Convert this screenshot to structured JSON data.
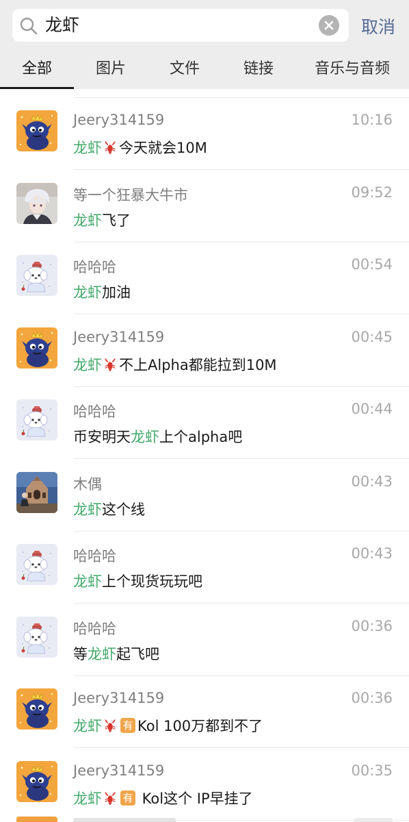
{
  "search": {
    "query": "龙虾",
    "cancel_label": "取消"
  },
  "tabs": [
    {
      "label": "全部",
      "active": true
    },
    {
      "label": "图片",
      "active": false
    },
    {
      "label": "文件",
      "active": false
    },
    {
      "label": "链接",
      "active": false
    },
    {
      "label": "音乐与音频",
      "active": false
    }
  ],
  "colors": {
    "highlight": "#42a96a",
    "cancel": "#576b95",
    "badge": "#f0a54b"
  },
  "results": [
    {
      "name": "Jeery314159",
      "time": "10:16",
      "avatar": "dragon-avatar",
      "message": [
        {
          "t": "龙虾",
          "hl": true
        },
        {
          "icon": "lobster"
        },
        {
          "t": "今天就会10M"
        }
      ]
    },
    {
      "name": "等一个狂暴大牛市",
      "time": "09:52",
      "avatar": "anime-boy-avatar",
      "message": [
        {
          "t": "龙虾",
          "hl": true
        },
        {
          "t": "飞了"
        }
      ]
    },
    {
      "name": "哈哈哈",
      "time": "00:54",
      "avatar": "dog-avatar",
      "message": [
        {
          "t": "龙虾",
          "hl": true
        },
        {
          "t": "加油"
        }
      ]
    },
    {
      "name": "Jeery314159",
      "time": "00:45",
      "avatar": "dragon-avatar",
      "message": [
        {
          "t": "龙虾",
          "hl": true
        },
        {
          "icon": "lobster"
        },
        {
          "t": "不上Alpha都能拉到10M"
        }
      ]
    },
    {
      "name": "哈哈哈",
      "time": "00:44",
      "avatar": "dog-avatar",
      "message": [
        {
          "t": "币安明天"
        },
        {
          "t": "龙虾",
          "hl": true
        },
        {
          "t": "上个alpha吧"
        }
      ]
    },
    {
      "name": "木偶",
      "time": "00:43",
      "avatar": "church-avatar",
      "message": [
        {
          "t": "龙虾",
          "hl": true
        },
        {
          "t": "这个线"
        }
      ]
    },
    {
      "name": "哈哈哈",
      "time": "00:43",
      "avatar": "dog-avatar",
      "message": [
        {
          "t": "龙虾",
          "hl": true
        },
        {
          "t": "上个现货玩玩吧"
        }
      ]
    },
    {
      "name": "哈哈哈",
      "time": "00:36",
      "avatar": "dog-avatar",
      "message": [
        {
          "t": "等"
        },
        {
          "t": "龙虾",
          "hl": true
        },
        {
          "t": "起飞吧"
        }
      ]
    },
    {
      "name": "Jeery314159",
      "time": "00:36",
      "avatar": "dragon-avatar",
      "message": [
        {
          "t": "龙虾",
          "hl": true
        },
        {
          "icon": "lobster"
        },
        {
          "badge": "有"
        },
        {
          "t": "Kol 100万都到不了"
        }
      ]
    },
    {
      "name": "Jeery314159",
      "time": "00:35",
      "avatar": "dragon-avatar",
      "message": [
        {
          "t": "龙虾",
          "hl": true
        },
        {
          "icon": "lobster"
        },
        {
          "badge": "有"
        },
        {
          "t": " Kol这个 IP早挂了"
        }
      ]
    }
  ]
}
